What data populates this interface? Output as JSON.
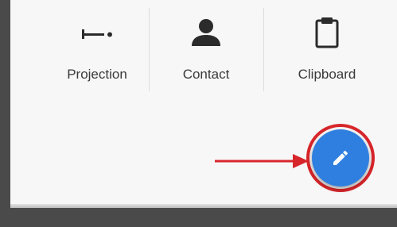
{
  "actions": [
    {
      "label": "Projection",
      "icon": "projection-icon"
    },
    {
      "label": "Contact",
      "icon": "contact-icon"
    },
    {
      "label": "Clipboard",
      "icon": "clipboard-icon"
    }
  ],
  "fab": {
    "icon": "pencil-edit-icon",
    "color": "#2f7fe0"
  },
  "annotation": {
    "arrow_color": "#d7262b",
    "highlight_color": "#d7262b"
  },
  "colors": {
    "frame": "#4a4a4a",
    "sheet_background": "#f7f7f7",
    "label_text": "#3a3a3a"
  }
}
